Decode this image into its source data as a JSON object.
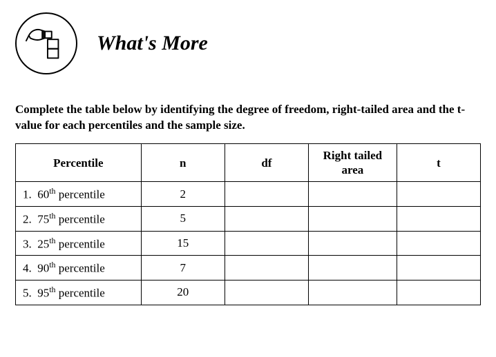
{
  "header": {
    "title": "What's More",
    "icon_name": "hand-stacking-blocks-icon"
  },
  "instructions": "Complete the table below by identifying the degree of freedom, right-tailed area and the t-value for each percentiles and the sample size.",
  "table": {
    "headers": {
      "percentile": "Percentile",
      "n": "n",
      "df": "df",
      "right_tailed": "Right tailed area",
      "t": "t"
    },
    "rows": [
      {
        "index": "1.",
        "percentile_num": "60",
        "percentile_suffix": "th",
        "percentile_word": "percentile",
        "n": "2",
        "df": "",
        "right_tailed": "",
        "t": ""
      },
      {
        "index": "2.",
        "percentile_num": "75",
        "percentile_suffix": "th",
        "percentile_word": "percentile",
        "n": "5",
        "df": "",
        "right_tailed": "",
        "t": ""
      },
      {
        "index": "3.",
        "percentile_num": "25",
        "percentile_suffix": "th",
        "percentile_word": "percentile",
        "n": "15",
        "df": "",
        "right_tailed": "",
        "t": ""
      },
      {
        "index": "4.",
        "percentile_num": "90",
        "percentile_suffix": "th",
        "percentile_word": "percentile",
        "n": "7",
        "df": "",
        "right_tailed": "",
        "t": ""
      },
      {
        "index": "5.",
        "percentile_num": "95",
        "percentile_suffix": "th",
        "percentile_word": "percentile",
        "n": "20",
        "df": "",
        "right_tailed": "",
        "t": ""
      }
    ]
  }
}
